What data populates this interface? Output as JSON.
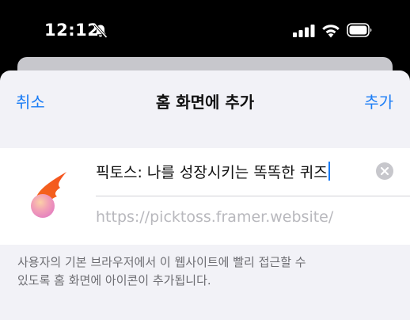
{
  "status_bar": {
    "time": "12:12",
    "icons": [
      "bell-slash-icon",
      "cellular-signal-icon",
      "wifi-icon",
      "battery-icon"
    ]
  },
  "sheet": {
    "cancel_label": "취소",
    "title": "홈 화면에 추가",
    "add_label": "추가"
  },
  "form": {
    "app_icon": "fire-ball-icon",
    "name_value": "픽토스: 나를 성장시키는 똑똑한 퀴즈",
    "url": "https://picktoss.framer.website/"
  },
  "description": {
    "line1": "사용자의 기본 브라우저에서 이 웹사이트에 빨리 접근할 수",
    "line2": "있도록 홈 화면에 아이콘이 추가됩니다."
  },
  "colors": {
    "accent": "#1a7cf5",
    "sheet_bg": "#f2f2f7",
    "flame_orange": "#f26522",
    "flame_pink": "#e88cc4"
  }
}
